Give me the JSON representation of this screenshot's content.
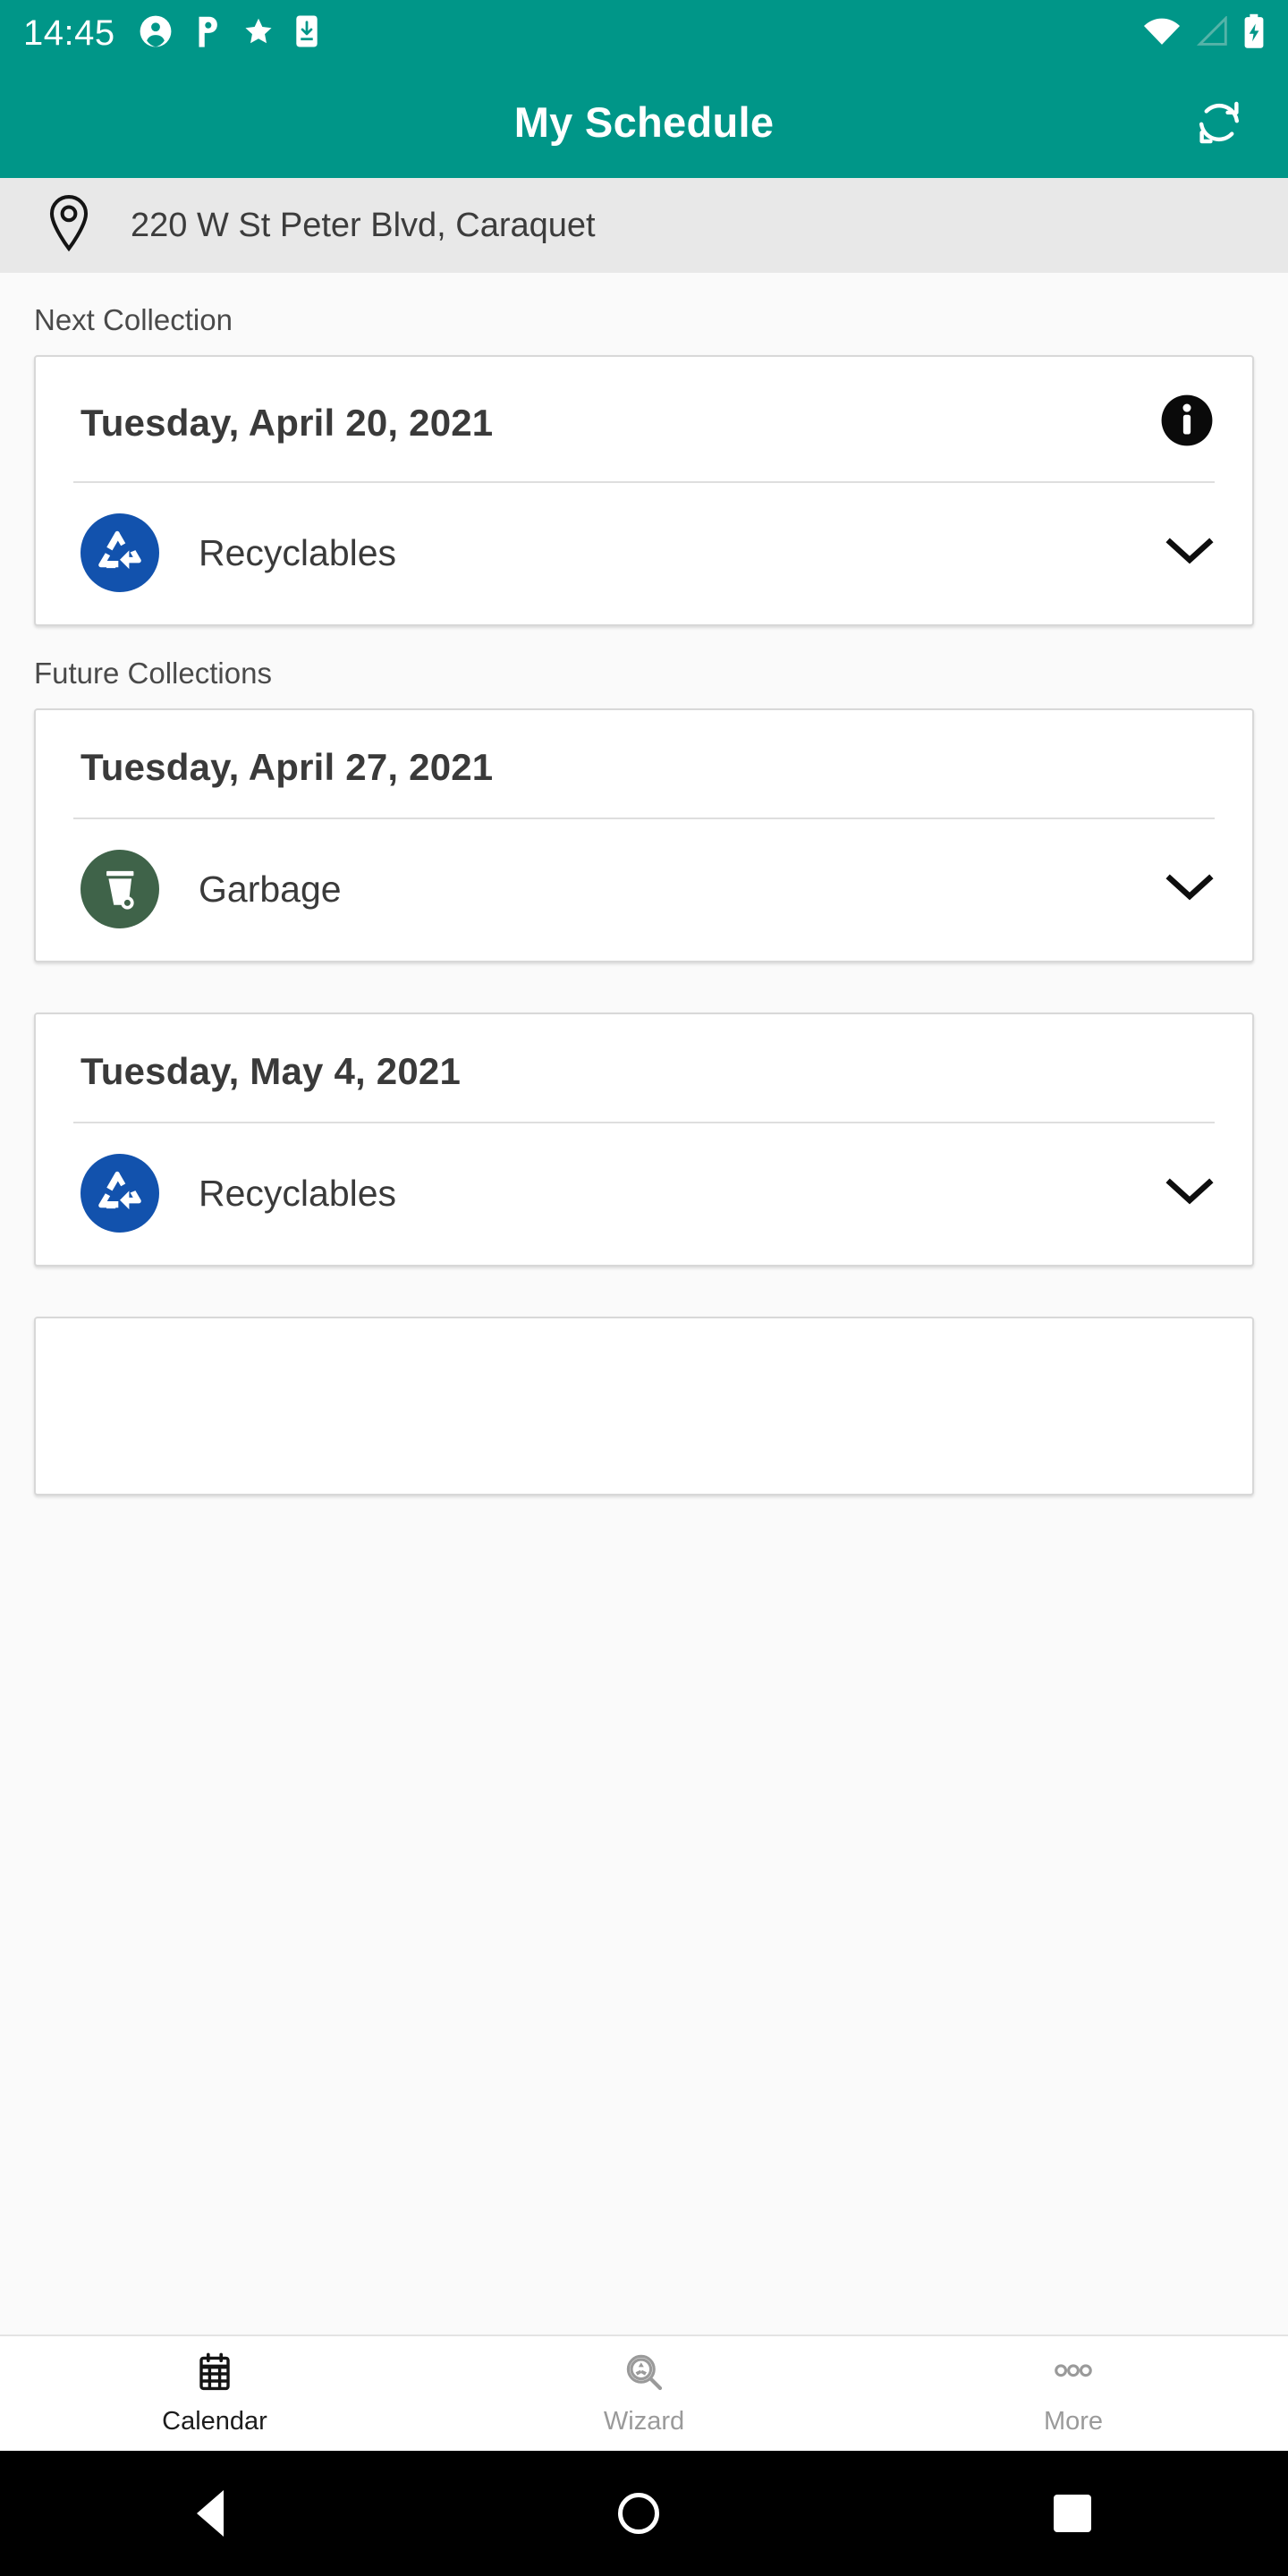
{
  "status_bar": {
    "time": "14:45",
    "left_icons": [
      "account-icon",
      "p-app-icon",
      "star-icon",
      "download-icon"
    ],
    "right_icons": [
      "wifi-icon",
      "cellular-signal-icon",
      "battery-charging-icon"
    ]
  },
  "app_bar": {
    "title": "My Schedule",
    "action_icon": "refresh-icon"
  },
  "address_bar": {
    "icon": "location-pin-icon",
    "address": "220 W St Peter Blvd, Caraquet"
  },
  "sections": {
    "next_label": "Next Collection",
    "future_label": "Future Collections"
  },
  "next_collection": {
    "date": "Tuesday, April 20, 2021",
    "info_icon": "info-icon",
    "items": [
      {
        "label": "Recyclables",
        "icon": "recycle-icon",
        "color": "#1252ad",
        "expand_icon": "chevron-down-icon"
      }
    ]
  },
  "future_collections": [
    {
      "date": "Tuesday, April 27, 2021",
      "items": [
        {
          "label": "Garbage",
          "icon": "trash-bin-icon",
          "color": "#3f6349",
          "expand_icon": "chevron-down-icon"
        }
      ]
    },
    {
      "date": "Tuesday, May 4, 2021",
      "items": [
        {
          "label": "Recyclables",
          "icon": "recycle-icon",
          "color": "#1252ad",
          "expand_icon": "chevron-down-icon"
        }
      ]
    }
  ],
  "bottom_nav": [
    {
      "label": "Calendar",
      "icon": "calendar-icon",
      "active": true
    },
    {
      "label": "Wizard",
      "icon": "recycle-search-icon",
      "active": false
    },
    {
      "label": "More",
      "icon": "more-dots-icon",
      "active": false
    }
  ],
  "android_nav": {
    "back": "back-triangle-icon",
    "home": "home-circle-icon",
    "recents": "recents-square-icon"
  },
  "colors": {
    "primary_teal": "#009688",
    "recycle_blue": "#1252ad",
    "garbage_green": "#3f6349",
    "page_background": "#fafafa",
    "address_background": "#e8e8e8"
  }
}
